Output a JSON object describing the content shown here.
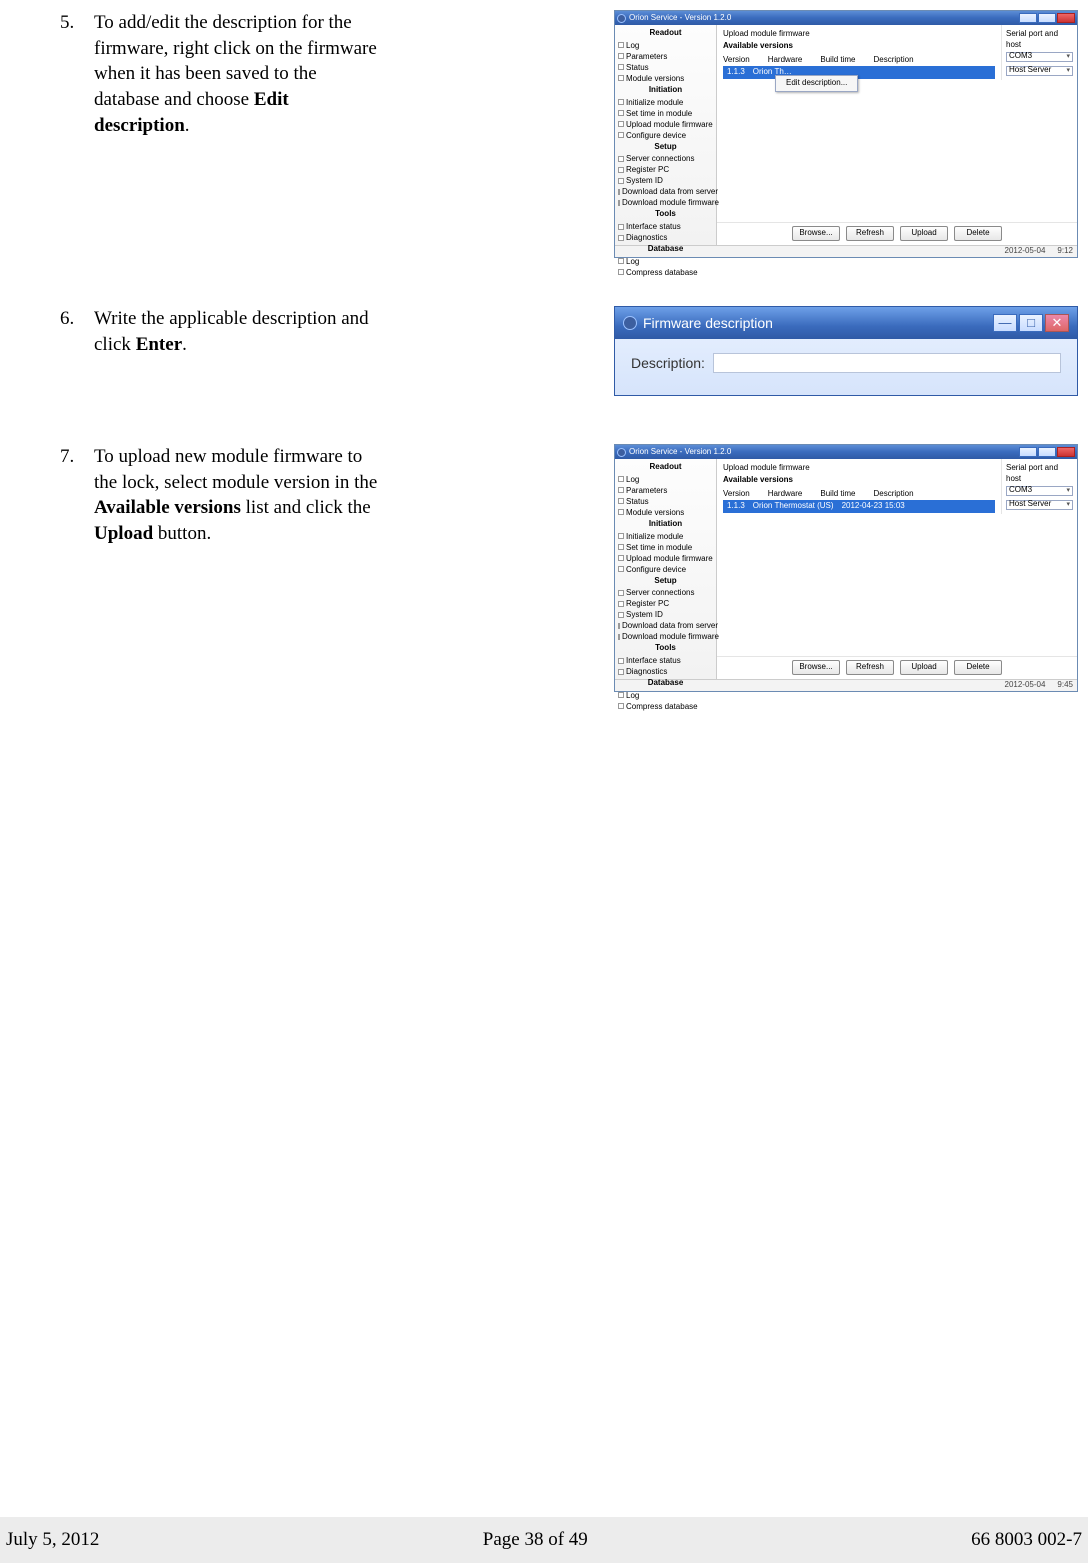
{
  "steps": {
    "s5": {
      "num": "5.",
      "t1": "To add/edit the description for the firmware, right click on the firmware when it has been saved to the database and choose ",
      "bold": "Edit description",
      "t2": "."
    },
    "s6": {
      "num": "6.",
      "t1": "Write the applicable description and click ",
      "bold": "Enter",
      "t2": "."
    },
    "s7": {
      "num": "7.",
      "t1": "To upload new module firmware to the lock, select module version in the ",
      "bold1": "Available versions",
      "t2": " list and click the ",
      "bold2": "Upload",
      "t3": " button."
    }
  },
  "app": {
    "title": "Orion Service - Version  1.2.0",
    "upload_label": "Upload module firmware",
    "avail_label": "Available versions",
    "col_version": "Version",
    "col_hardware": "Hardware",
    "col_build": "Build time",
    "col_desc": "Description",
    "row_a": {
      "ver": "1.1.3",
      "hw": "Orion Th…"
    },
    "row_b": {
      "ver": "1.1.3",
      "hw": "Orion Thermostat (US)",
      "build": "2012-04-23   15:03"
    },
    "ctx": "Edit description...",
    "right_label": "Serial port and host",
    "combo1": "COM3",
    "combo2": "Host Server",
    "btn_browse": "Browse...",
    "btn_refresh": "Refresh",
    "btn_upload": "Upload",
    "btn_delete": "Delete",
    "status_date_a": "2012-05-04",
    "status_time_a": "9:12",
    "status_date_b": "2012-05-04",
    "status_time_b": "9:45",
    "sidebar": {
      "readout_h": "Readout",
      "readout": [
        "Log",
        "Parameters",
        "Status",
        "Module versions"
      ],
      "init_h": "Initiation",
      "init": [
        "Initialize module",
        "Set time in module",
        "Upload module firmware",
        "Configure device"
      ],
      "setup_h": "Setup",
      "setup": [
        "Server connections",
        "Register PC",
        "System ID",
        "Download data from server",
        "Download module firmware"
      ],
      "tools_h": "Tools",
      "tools": [
        "Interface status",
        "Diagnostics"
      ],
      "db_h": "Database",
      "db": [
        "Log",
        "Compress database"
      ]
    }
  },
  "dialog": {
    "title": "Firmware description",
    "label": "Description:",
    "min": "—",
    "max": "□",
    "close": "✕"
  },
  "footer": {
    "left": "July 5, 2012",
    "center": "Page 38 of 49",
    "right": "66 8003 002-7"
  }
}
